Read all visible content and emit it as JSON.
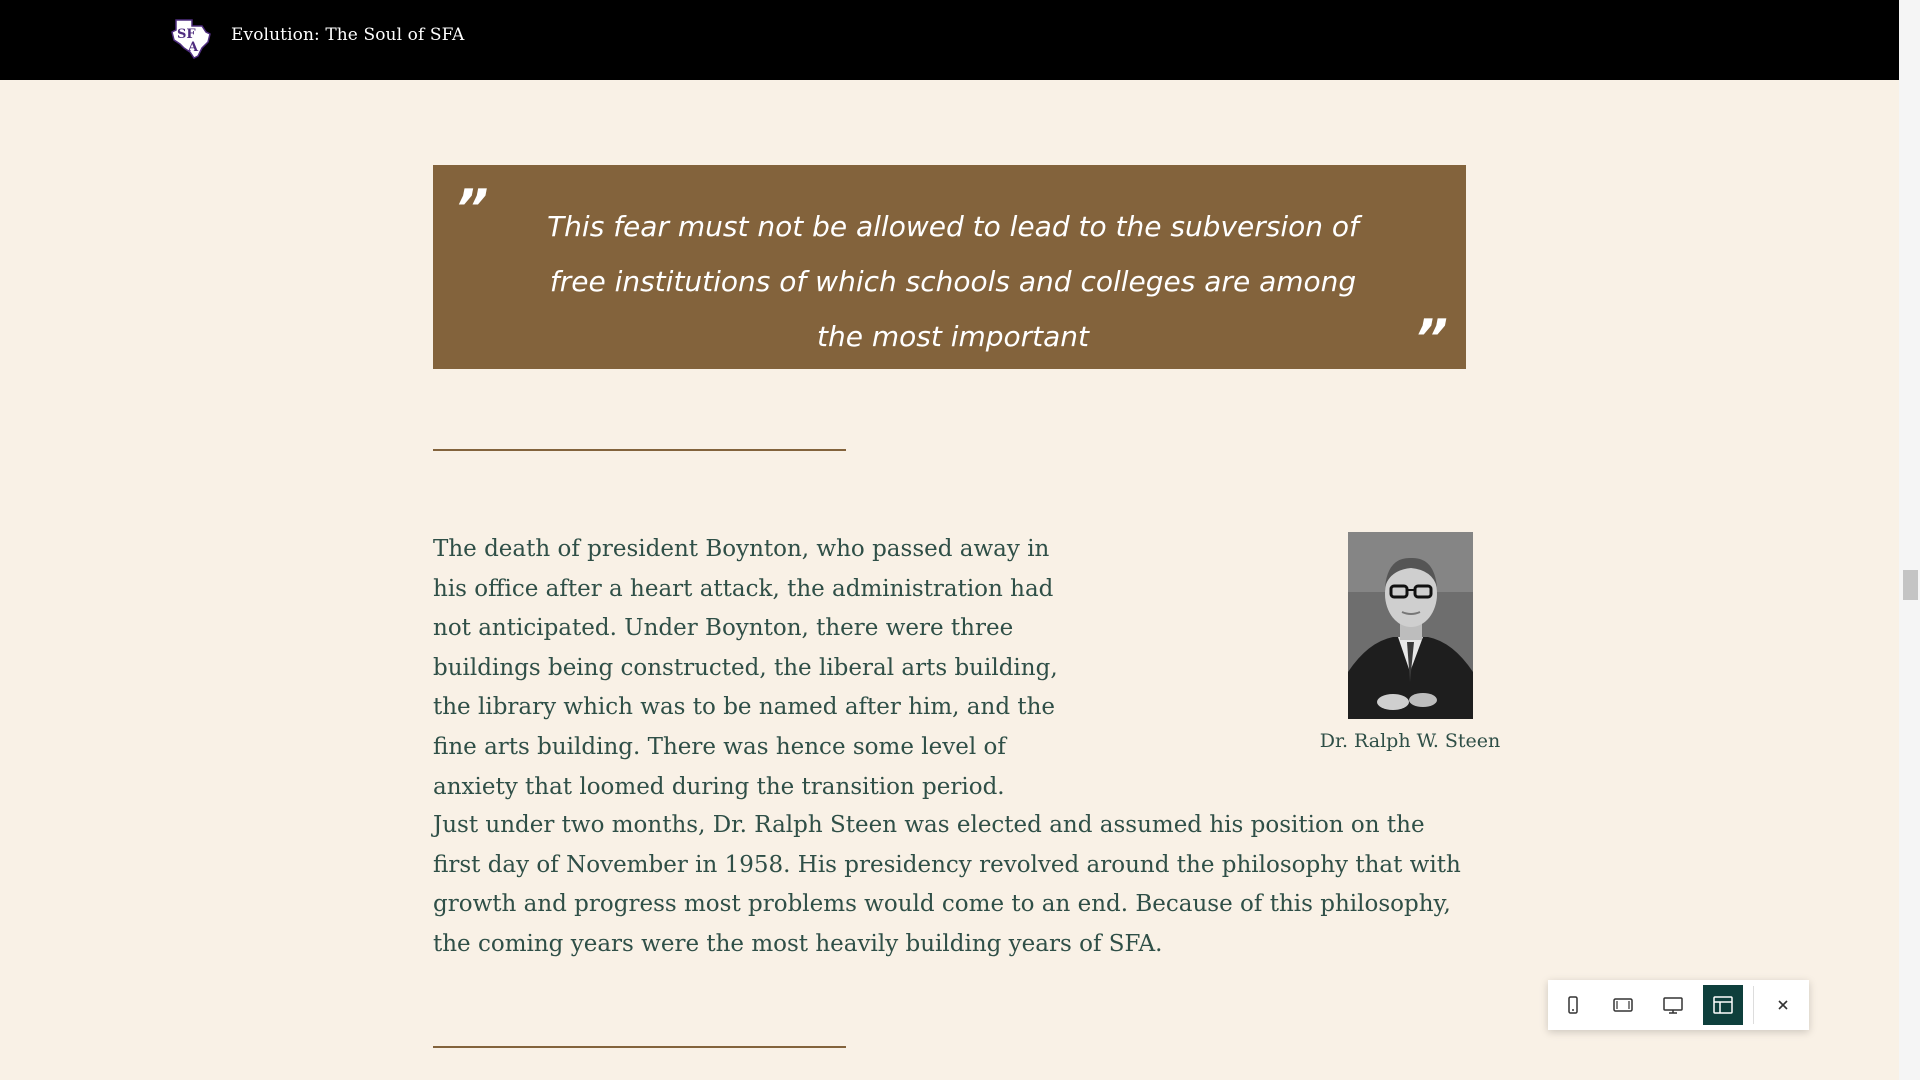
{
  "header": {
    "site_title": "Evolution: The Soul of SFA",
    "logo_icon": "sfa-texas-logo-icon"
  },
  "quote": {
    "open_mark": "”",
    "close_mark": "”",
    "text": "This fear must not be allowed to lead to the subversion of free institutions of which schools and colleges are among the most important"
  },
  "article": {
    "paragraph_1": "The death of president Boynton, who passed away in his office after a heart attack, the administration had not anticipated. Under Boynton, there were three buildings being constructed, the liberal arts building, the library which was to be named after him, and the fine arts building. There was hence some level of anxiety that loomed during the transition period.",
    "paragraph_2": "Just under two months, Dr. Ralph Steen was elected and assumed his position on the first day of November in 1958. His presidency revolved around the philosophy that with growth and progress most problems would come to an end. Because of this philosophy, the coming years were the most heavily building years of SFA.",
    "image_caption": "Dr. Ralph W. Steen"
  },
  "device_toolbar": {
    "buttons": [
      {
        "icon": "mobile-icon",
        "active": false
      },
      {
        "icon": "tablet-icon",
        "active": false
      },
      {
        "icon": "desktop-icon",
        "active": false
      },
      {
        "icon": "full-layout-icon",
        "active": true
      },
      {
        "icon": "close-icon",
        "active": false
      }
    ]
  },
  "colors": {
    "background": "#f9f1e6",
    "header": "#000000",
    "quote_box": "#83633c",
    "body_text": "#2f4f47",
    "divider": "#83633c",
    "toolbar_active": "#0e3f3c"
  }
}
